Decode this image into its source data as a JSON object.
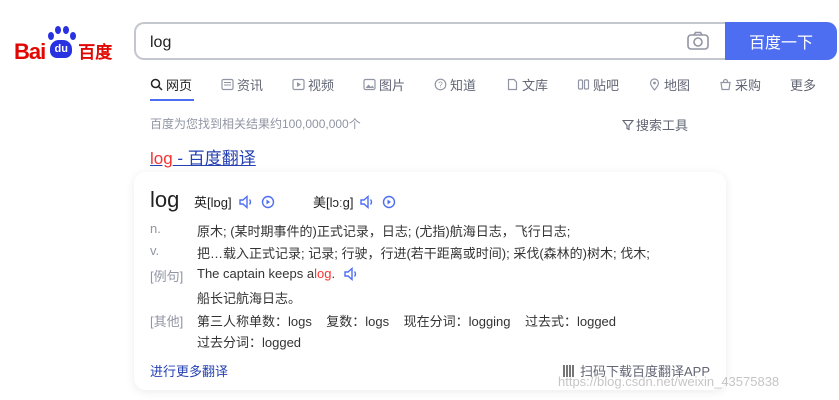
{
  "header": {
    "logo_bai": "Bai",
    "logo_du": "du",
    "logo_cn": "百度",
    "search_value": "log",
    "submit_label": "百度一下"
  },
  "tabs": [
    {
      "label": "网页",
      "icon": "search-icon",
      "active": true
    },
    {
      "label": "资讯",
      "icon": "news-icon"
    },
    {
      "label": "视频",
      "icon": "video-icon"
    },
    {
      "label": "图片",
      "icon": "image-icon"
    },
    {
      "label": "知道",
      "icon": "question-icon"
    },
    {
      "label": "文库",
      "icon": "document-icon"
    },
    {
      "label": "贴吧",
      "icon": "forum-icon"
    },
    {
      "label": "地图",
      "icon": "map-icon"
    },
    {
      "label": "采购",
      "icon": "shop-icon"
    },
    {
      "label": "更多"
    }
  ],
  "result_info": "百度为您找到相关结果约100,000,000个",
  "search_tools": "搜索工具",
  "result": {
    "title_word": "log",
    "title_rest": " - 百度翻译"
  },
  "dictionary": {
    "word": "log",
    "phonetic_uk": "英[lɒɡ]",
    "phonetic_us": "美[lɔːɡ]",
    "pos_n": "n.",
    "def_n": "原木; (某时期事件的)正式记录，日志; (尤指)航海日志，飞行日志;",
    "pos_v": "v.",
    "def_v": "把…载入正式记录; 记录; 行驶，行进(若干距离或时间); 采伐(森林的)树木; 伐木;",
    "example_label": "[例句]",
    "example_en_before": "The captain keeps a ",
    "example_en_word": "log",
    "example_en_after": ".",
    "example_cn": "船长记航海日志。",
    "other_label": "[其他]",
    "other_line1": "第三人称单数：logs    复数：logs    现在分词：logging    过去式：logged",
    "other_line2": "过去分词：logged",
    "more_link": "进行更多翻译",
    "qr_hint": "扫码下载百度翻译APP"
  },
  "watermark": "https://blog.csdn.net/weixin_43575838",
  "colors": {
    "brand_blue": "#4e6ef2",
    "logo_red": "#e10601",
    "logo_blue": "#2932e1",
    "link_blue": "#2440b3",
    "highlight_red": "#f73131"
  }
}
